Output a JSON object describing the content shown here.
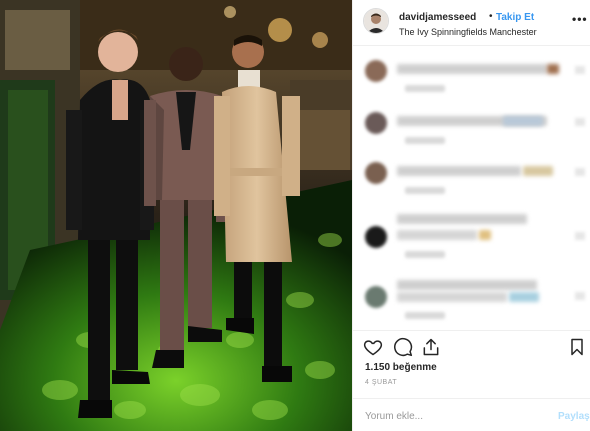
{
  "post": {
    "author": {
      "username": "davidjamesseed",
      "follow_label": "Takip Et",
      "separator": "•",
      "location": "The Ivy Spinningfields Manchester"
    },
    "more_icon": "more-horizontal-icon",
    "comments_note": "blurred comments",
    "actions": {
      "icons": [
        "heart-icon",
        "comment-icon",
        "share-icon",
        "bookmark-icon"
      ]
    },
    "likes": "1.150 beğenme",
    "date": "4 ŞUBAT",
    "comment_input": {
      "placeholder": "Yorum ekle...",
      "value": ""
    },
    "share_button": "Paylaş",
    "colors": {
      "link": "#3897f0",
      "share_disabled": "#b2dffc",
      "text": "#262626",
      "muted": "#999999"
    }
  }
}
